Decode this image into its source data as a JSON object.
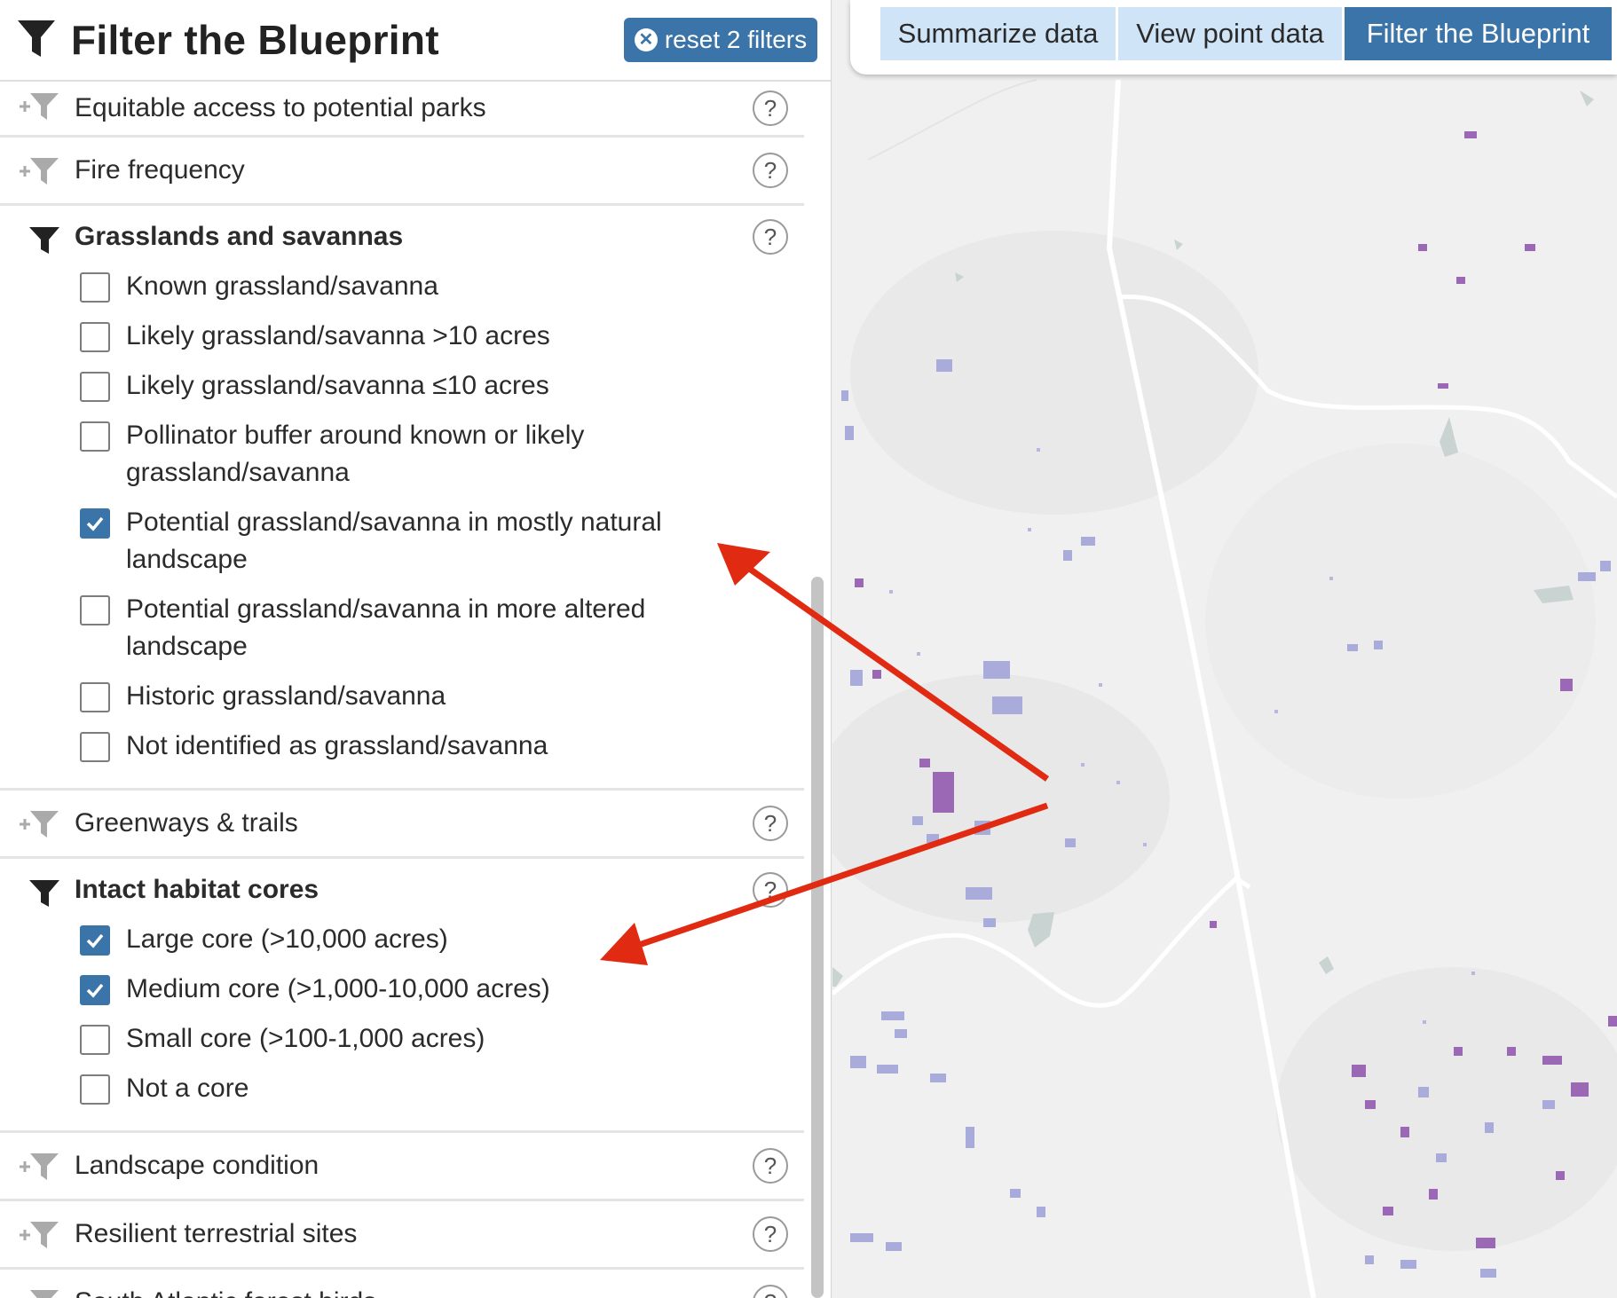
{
  "sidebar": {
    "title": "Filter the Blueprint",
    "reset_label": "reset 2 filters"
  },
  "tabs": [
    {
      "label": "Summarize data",
      "active": false
    },
    {
      "label": "View point data",
      "active": false
    },
    {
      "label": "Filter the Blueprint",
      "active": true
    }
  ],
  "filters": {
    "equitable": "Equitable access to potential parks",
    "fire": "Fire frequency",
    "grasslands": {
      "label": "Grasslands and savannas",
      "options": [
        {
          "label": "Known grassland/savanna",
          "checked": false
        },
        {
          "label": "Likely grassland/savanna >10 acres",
          "checked": false
        },
        {
          "label": "Likely grassland/savanna ≤10 acres",
          "checked": false
        },
        {
          "label": "Pollinator buffer around known or likely grassland/savanna",
          "checked": false
        },
        {
          "label": "Potential grassland/savanna in mostly natural landscape",
          "checked": true
        },
        {
          "label": "Potential grassland/savanna in more altered landscape",
          "checked": false
        },
        {
          "label": "Historic grassland/savanna",
          "checked": false
        },
        {
          "label": "Not identified as grassland/savanna",
          "checked": false
        }
      ]
    },
    "greenways": "Greenways & trails",
    "intact": {
      "label": "Intact habitat cores",
      "options": [
        {
          "label": "Large core (>10,000 acres)",
          "checked": true
        },
        {
          "label": "Medium core (>1,000-10,000 acres)",
          "checked": true
        },
        {
          "label": "Small core (>100-1,000 acres)",
          "checked": false
        },
        {
          "label": "Not a core",
          "checked": false
        }
      ]
    },
    "landscape": "Landscape condition",
    "resilient": "Resilient terrestrial sites",
    "forest_birds": "South Atlantic forest birds"
  },
  "help_symbol": "?",
  "colors": {
    "accent": "#3a74a8",
    "tab_inactive": "#cfe4f7",
    "arrow": "#e02a12",
    "patch_blue": "#a9acdb",
    "patch_purple": "#9a68b5"
  }
}
